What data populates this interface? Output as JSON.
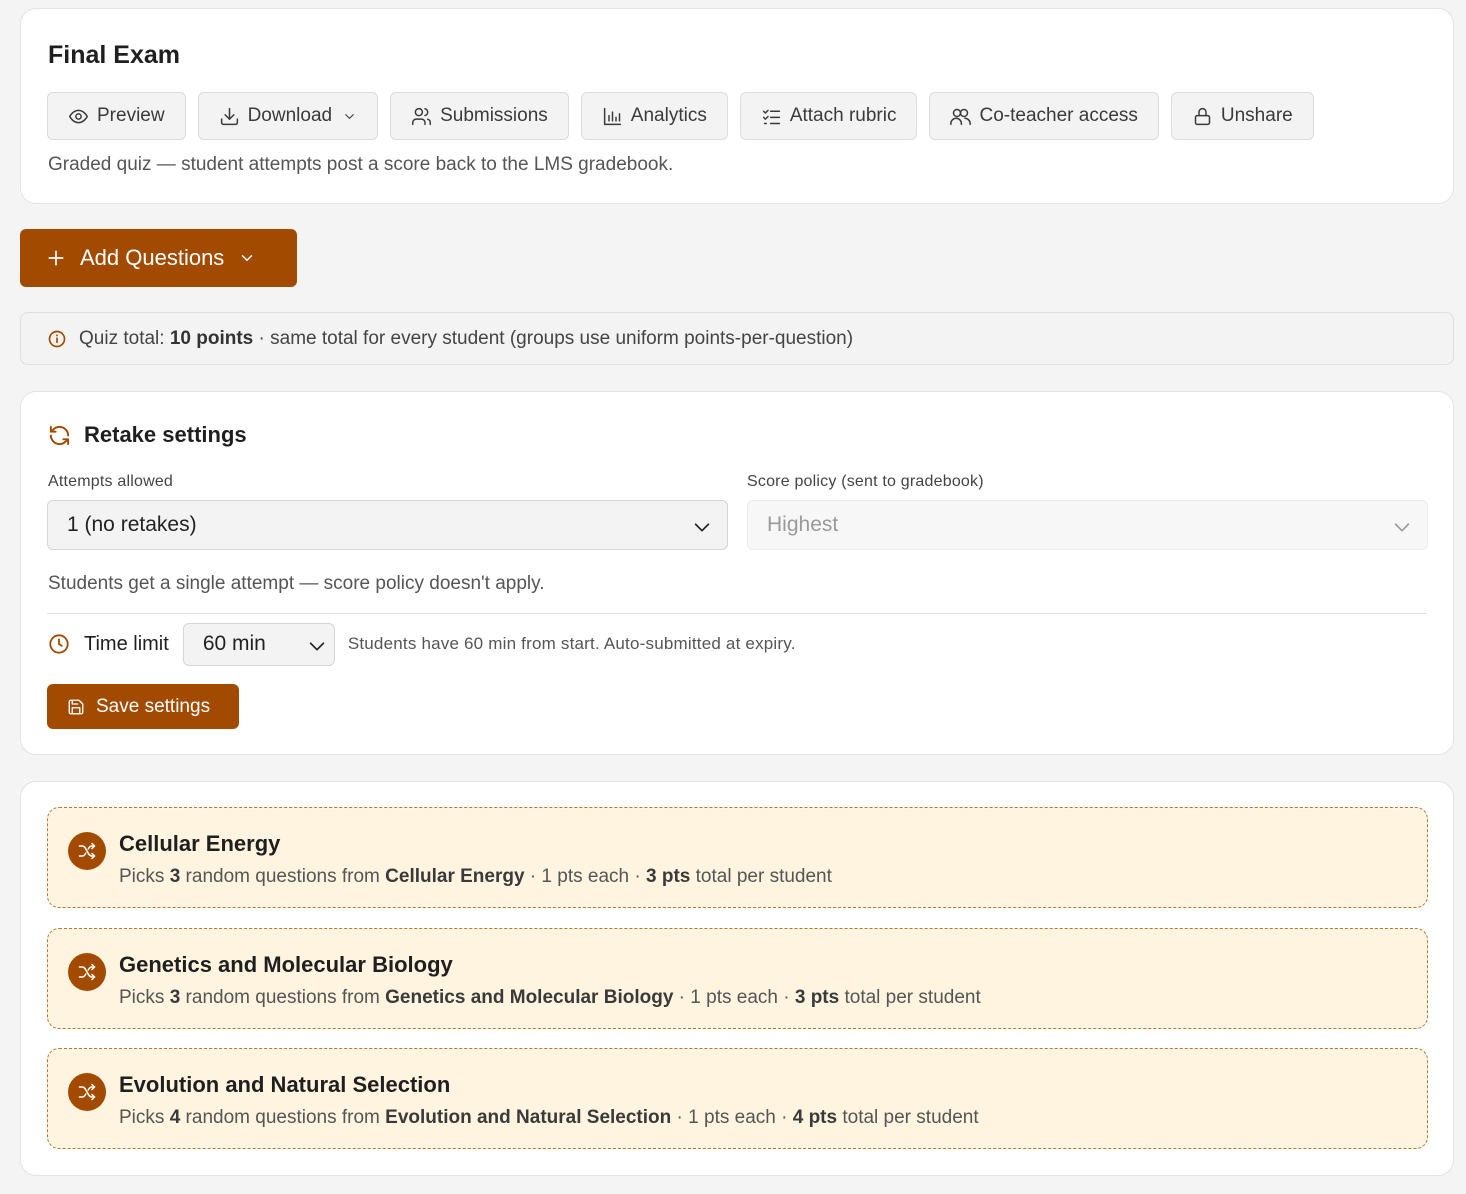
{
  "header": {
    "title": "Final Exam",
    "subtitle": "Graded quiz — student attempts post a score back to the LMS gradebook.",
    "toolbar": {
      "preview": "Preview",
      "download": "Download",
      "submissions": "Submissions",
      "analytics": "Analytics",
      "attach_rubric": "Attach rubric",
      "co_teacher": "Co-teacher access",
      "unshare": "Unshare"
    }
  },
  "add_questions": {
    "label": "Add Questions"
  },
  "info": {
    "prefix": "Quiz total:",
    "points": "10 points",
    "suffix": "· same total for every student (groups use uniform points-per-question)"
  },
  "retake": {
    "title": "Retake settings",
    "attempts_label": "Attempts allowed",
    "attempts_value": "1 (no retakes)",
    "policy_label": "Score policy (sent to gradebook)",
    "policy_value": "Highest",
    "note": "Students get a single attempt — score policy doesn't apply.",
    "time_label": "Time limit",
    "time_value": "60 min",
    "time_note": "Students have 60 min from start. Auto-submitted at expiry.",
    "save_label": "Save settings"
  },
  "groups": [
    {
      "name": "Cellular Energy",
      "picks": "Picks",
      "count": "3",
      "from": "random questions from",
      "source": "Cellular Energy",
      "each": "· 1 pts each ·",
      "total": "3 pts",
      "tail": "total per student"
    },
    {
      "name": "Genetics and Molecular Biology",
      "picks": "Picks",
      "count": "3",
      "from": "random questions from",
      "source": "Genetics and Molecular Biology",
      "each": "· 1 pts each ·",
      "total": "3 pts",
      "tail": "total per student"
    },
    {
      "name": "Evolution and Natural Selection",
      "picks": "Picks",
      "count": "4",
      "from": "random questions from",
      "source": "Evolution and Natural Selection",
      "each": "· 1 pts each ·",
      "total": "4 pts",
      "tail": "total per student"
    }
  ],
  "colors": {
    "accent": "#a24b00",
    "group_bg": "#fff4e0",
    "page_bg": "#f4f4f4"
  },
  "icons": [
    "eye-icon",
    "download-icon",
    "users-icon",
    "bar-chart-icon",
    "checklist-icon",
    "user-group-icon",
    "lock-icon",
    "plus-icon",
    "info-icon",
    "refresh-icon",
    "clock-icon",
    "save-icon",
    "shuffle-icon"
  ]
}
